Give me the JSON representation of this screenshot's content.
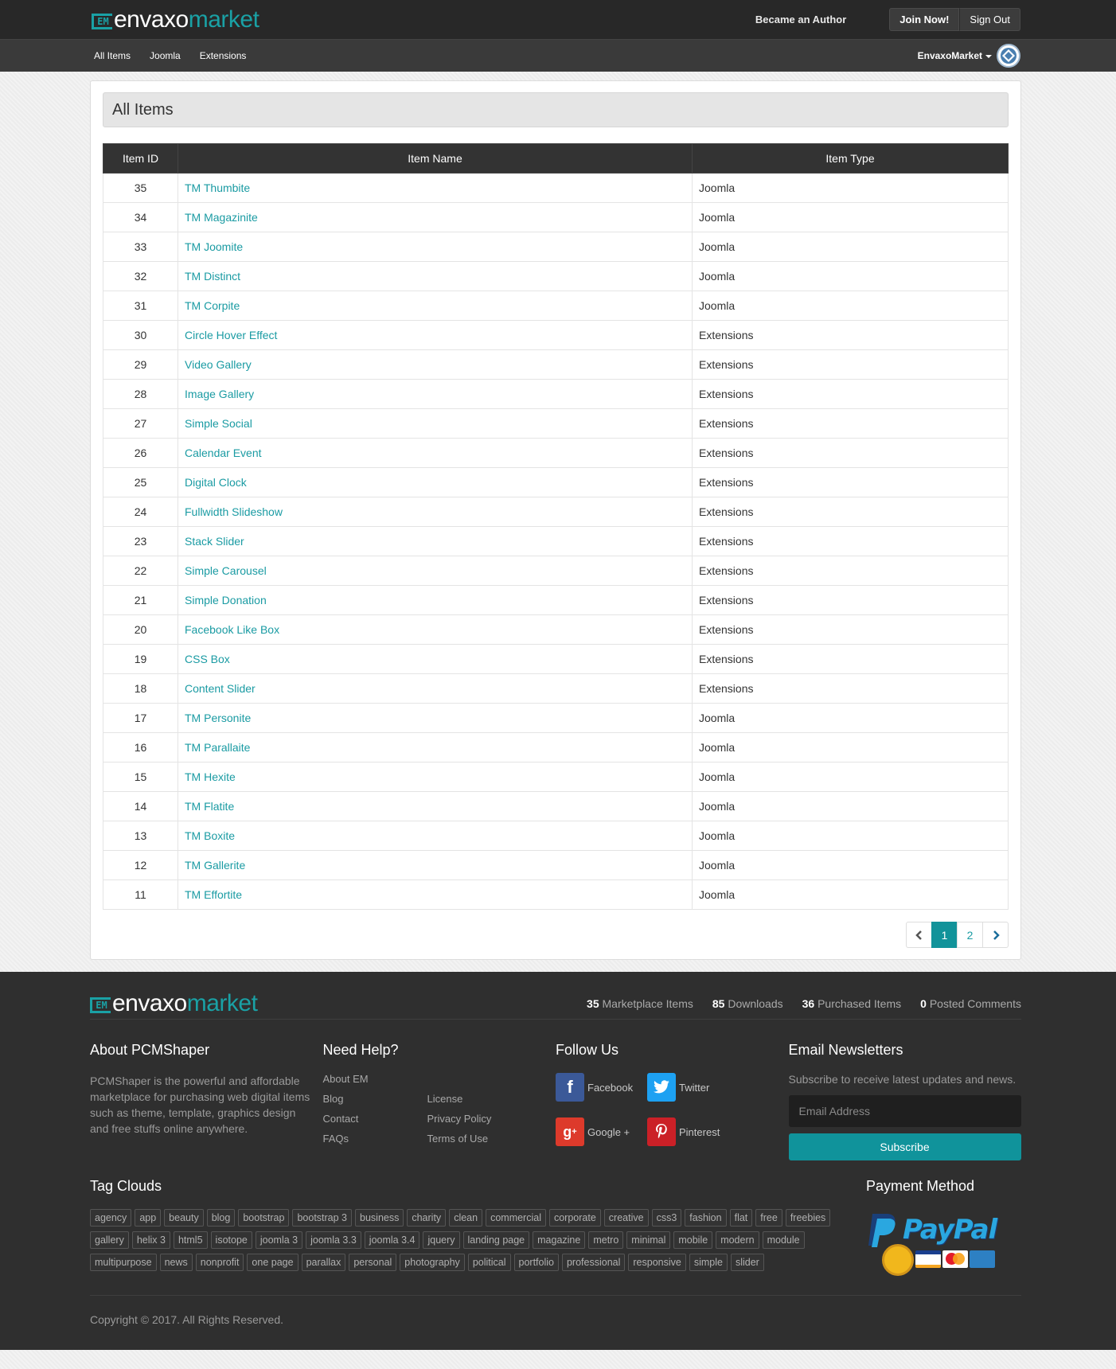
{
  "brand": {
    "part1": "envaxo",
    "part2": "market",
    "mark": "EM"
  },
  "header": {
    "became_author": "Became an Author",
    "join_now": "Join Now!",
    "sign_out": "Sign Out"
  },
  "nav": {
    "items": [
      "All Items",
      "Joomla",
      "Extensions"
    ],
    "user": "EnvaxoMarket"
  },
  "panel": {
    "title": "All Items",
    "columns": [
      "Item ID",
      "Item Name",
      "Item Type"
    ],
    "rows": [
      [
        "35",
        "TM Thumbite",
        "Joomla"
      ],
      [
        "34",
        "TM Magazinite",
        "Joomla"
      ],
      [
        "33",
        "TM Joomite",
        "Joomla"
      ],
      [
        "32",
        "TM Distinct",
        "Joomla"
      ],
      [
        "31",
        "TM Corpite",
        "Joomla"
      ],
      [
        "30",
        "Circle Hover Effect",
        "Extensions"
      ],
      [
        "29",
        "Video Gallery",
        "Extensions"
      ],
      [
        "28",
        "Image Gallery",
        "Extensions"
      ],
      [
        "27",
        "Simple Social",
        "Extensions"
      ],
      [
        "26",
        "Calendar Event",
        "Extensions"
      ],
      [
        "25",
        "Digital Clock",
        "Extensions"
      ],
      [
        "24",
        "Fullwidth Slideshow",
        "Extensions"
      ],
      [
        "23",
        "Stack Slider",
        "Extensions"
      ],
      [
        "22",
        "Simple Carousel",
        "Extensions"
      ],
      [
        "21",
        "Simple Donation",
        "Extensions"
      ],
      [
        "20",
        "Facebook Like Box",
        "Extensions"
      ],
      [
        "19",
        "CSS Box",
        "Extensions"
      ],
      [
        "18",
        "Content Slider",
        "Extensions"
      ],
      [
        "17",
        "TM Personite",
        "Joomla"
      ],
      [
        "16",
        "TM Parallaite",
        "Joomla"
      ],
      [
        "15",
        "TM Hexite",
        "Joomla"
      ],
      [
        "14",
        "TM Flatite",
        "Joomla"
      ],
      [
        "13",
        "TM Boxite",
        "Joomla"
      ],
      [
        "12",
        "TM Gallerite",
        "Joomla"
      ],
      [
        "11",
        "TM Effortite",
        "Joomla"
      ]
    ],
    "pagination": {
      "pages": [
        "1",
        "2"
      ],
      "current": "1"
    }
  },
  "footer": {
    "stats": [
      {
        "num": "35",
        "label": "Marketplace Items"
      },
      {
        "num": "85",
        "label": "Downloads"
      },
      {
        "num": "36",
        "label": "Purchased Items"
      },
      {
        "num": "0",
        "label": "Posted Comments"
      }
    ],
    "about": {
      "title": "About PCMShaper",
      "text": "PCMShaper is the powerful and affordable marketplace for purchasing web digital items such as theme, template, graphics design and free stuffs online anywhere."
    },
    "help": {
      "title": "Need Help?",
      "col1": [
        "About EM",
        "Blog",
        "Contact",
        "FAQs"
      ],
      "col2": [
        "License",
        "Privacy Policy",
        "Terms of Use"
      ]
    },
    "follow": {
      "title": "Follow Us",
      "facebook": "Facebook",
      "twitter": "Twitter",
      "google": "Google +",
      "pinterest": "Pinterest"
    },
    "newsletter": {
      "title": "Email Newsletters",
      "text": "Subscribe to receive latest updates and news.",
      "placeholder": "Email Address",
      "button": "Subscribe"
    },
    "tags_title": "Tag Clouds",
    "tags": [
      "agency",
      "app",
      "beauty",
      "blog",
      "bootstrap",
      "bootstrap 3",
      "business",
      "charity",
      "clean",
      "commercial",
      "corporate",
      "creative",
      "css3",
      "fashion",
      "flat",
      "free",
      "freebies",
      "gallery",
      "helix 3",
      "html5",
      "isotope",
      "joomla 3",
      "joomla 3.3",
      "joomla 3.4",
      "jquery",
      "landing page",
      "magazine",
      "metro",
      "minimal",
      "mobile",
      "modern",
      "module",
      "multipurpose",
      "news",
      "nonprofit",
      "one page",
      "parallax",
      "personal",
      "photography",
      "political",
      "portfolio",
      "professional",
      "responsive",
      "simple",
      "slider"
    ],
    "payment_title": "Payment Method",
    "copyright": "Copyright © 2017. All Rights Reserved."
  },
  "colors": {
    "accent": "#1aa1a5",
    "header_bg": "#282828",
    "nav_bg": "#3a3a3a",
    "footer_bg": "#2f2f2f",
    "link": "#1a9ba3"
  }
}
